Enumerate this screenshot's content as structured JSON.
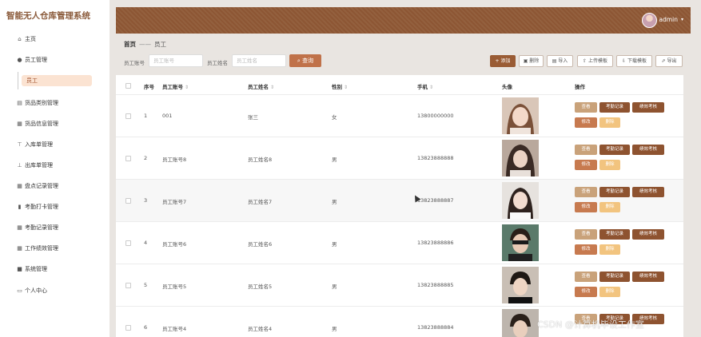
{
  "app": {
    "title": "智能无人仓库管理系统"
  },
  "sidebar": {
    "items": [
      {
        "label": "主页",
        "icon": "home-icon"
      },
      {
        "label": "员工管理",
        "icon": "user-icon"
      },
      {
        "label": "货品类别管理",
        "icon": "category-icon"
      },
      {
        "label": "货品信息管理",
        "icon": "grid-icon"
      },
      {
        "label": "入库单管理",
        "icon": "inbound-icon"
      },
      {
        "label": "出库单管理",
        "icon": "outbound-icon"
      },
      {
        "label": "盘点记录管理",
        "icon": "grid-icon"
      },
      {
        "label": "考勤打卡管理",
        "icon": "chart-icon"
      },
      {
        "label": "考勤记录管理",
        "icon": "grid-icon"
      },
      {
        "label": "工作绩效管理",
        "icon": "grid-icon"
      },
      {
        "label": "系统管理",
        "icon": "system-icon"
      },
      {
        "label": "个人中心",
        "icon": "profile-icon"
      }
    ],
    "subitem": "员工"
  },
  "header": {
    "username": "admin",
    "caret": "▾"
  },
  "breadcrumb": {
    "home": "首页",
    "sep": "——",
    "current": "员工"
  },
  "search": {
    "account_label": "员工账号",
    "account_placeholder": "员工账号",
    "name_label": "员工姓名",
    "name_placeholder": "员工姓名",
    "button": "查询"
  },
  "toolbar": {
    "add": "添加",
    "delete": "删除",
    "import": "导入",
    "upload_template": "上传模板",
    "download_template": "下载模板",
    "export": "导出"
  },
  "table": {
    "headers": {
      "index": "序号",
      "account": "员工账号",
      "name": "员工姓名",
      "gender": "性别",
      "phone": "手机",
      "avatar": "头像",
      "actions": "操作"
    },
    "rows": [
      {
        "index": "1",
        "account": "001",
        "name": "张三",
        "gender": "女",
        "phone": "13800000000"
      },
      {
        "index": "2",
        "account": "员工账号8",
        "name": "员工姓名8",
        "gender": "男",
        "phone": "13823888888"
      },
      {
        "index": "3",
        "account": "员工账号7",
        "name": "员工姓名7",
        "gender": "男",
        "phone": "13823888887"
      },
      {
        "index": "4",
        "account": "员工账号6",
        "name": "员工姓名6",
        "gender": "男",
        "phone": "13823888886"
      },
      {
        "index": "5",
        "account": "员工账号5",
        "name": "员工姓名5",
        "gender": "男",
        "phone": "13823888885"
      },
      {
        "index": "6",
        "account": "员工账号4",
        "name": "员工姓名4",
        "gender": "男",
        "phone": "13823888884"
      }
    ],
    "actions": {
      "view": "查看",
      "attendance": "考勤记录",
      "performance": "绩效考核",
      "edit": "修改",
      "delete": "删除"
    }
  },
  "watermark": "CSDN @计算机毕设工作室",
  "colors": {
    "topbar": "#8d5634",
    "primary": "#9a5c35",
    "search_button": "#c0724a",
    "view_button": "#c9a27a",
    "dark_button": "#8e5330",
    "edit_button": "#c77a4f",
    "delete_button": "#f2c47f",
    "sub_active_bg": "#fbe3d2"
  }
}
